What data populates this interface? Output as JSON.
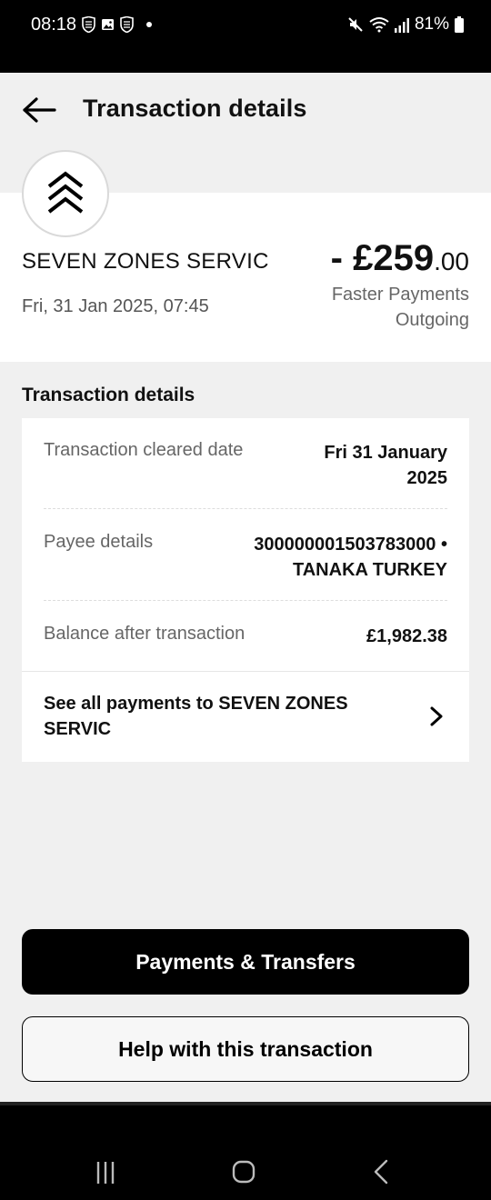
{
  "status_bar": {
    "time": "08:18",
    "battery": "81%",
    "icons_left": [
      "shield-icon",
      "gallery-icon",
      "shield-icon"
    ],
    "icons_right": [
      "mute-icon",
      "wifi-icon",
      "signal-icon",
      "battery-icon"
    ]
  },
  "header": {
    "title": "Transaction details",
    "back_icon": "arrow-left-icon"
  },
  "summary": {
    "merchant_name": "SEVEN ZONES SERVIC",
    "date_time": "Fri, 31 Jan 2025, 07:45",
    "amount_main": "- £259",
    "amount_pence": ".00",
    "payment_type_line1": "Faster Payments",
    "payment_type_line2": "Outgoing",
    "logo_icon": "chevrons-up-icon"
  },
  "details": {
    "section_title": "Transaction details",
    "rows": [
      {
        "label": "Transaction cleared date",
        "value_line1": "Fri 31 January",
        "value_line2": "2025"
      },
      {
        "label": "Payee details",
        "value_line1": "300000001503783000 •",
        "value_line2": "TANAKA TURKEY"
      },
      {
        "label": "Balance after transaction",
        "value_line1": "£1,982.38",
        "value_line2": ""
      }
    ],
    "see_all_line1": "See all payments to SEVEN ZONES",
    "see_all_line2": "SERVIC"
  },
  "actions": {
    "primary_label": "Payments & Transfers",
    "secondary_label": "Help with this transaction"
  },
  "nav_bar": {
    "buttons": [
      "recent-apps-icon",
      "home-icon",
      "back-icon"
    ]
  }
}
